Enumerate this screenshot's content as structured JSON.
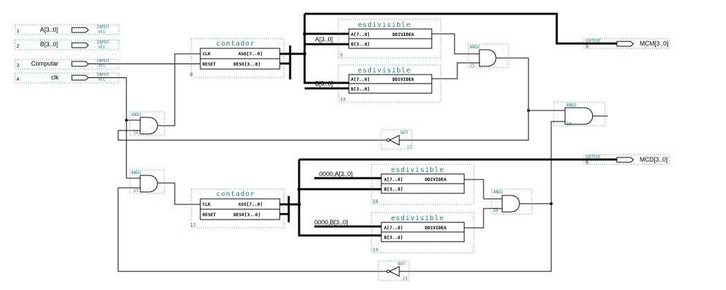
{
  "inputs": [
    {
      "num": "1",
      "name": "A[3..0]",
      "type": "INPUT",
      "vcc": "VCC"
    },
    {
      "num": "2",
      "name": "B[3..0]",
      "type": "INPUT",
      "vcc": "VCC"
    },
    {
      "num": "3",
      "name": "Computar",
      "type": "INPUT",
      "vcc": "VCC"
    },
    {
      "num": "4",
      "name": "clk",
      "type": "INPUT",
      "vcc": "VCC"
    }
  ],
  "outputs": [
    {
      "num": "5",
      "name": "MCM[3..0]",
      "type": "OUTPUT"
    },
    {
      "num": "6",
      "name": "MCD[3..0]",
      "type": "OUTPUT"
    }
  ],
  "contador_top": {
    "title": "contador",
    "num": "8",
    "port_clk": "CLK",
    "port_reset": "RESET",
    "port_aso": "ASO[7..0]",
    "port_deso": "DESO[3..0]"
  },
  "contador_bot": {
    "title": "contador",
    "num": "12",
    "port_clk": "CLK",
    "port_reset": "RESET",
    "port_aso": "ASO[7..0]",
    "port_deso": "DESO[3..0]"
  },
  "esdiv_9": {
    "title": "esdivisible",
    "num": "9",
    "port_a": "A[7..0]",
    "port_b": "B[3..0]",
    "port_out": "DDIVIDEA"
  },
  "esdiv_14": {
    "title": "esdivisible",
    "num": "14",
    "port_a": "A[7..0]",
    "port_b": "B[3..0]",
    "port_out": "DDIVIDEA"
  },
  "esdiv_18": {
    "title": "esdivisible",
    "num": "18",
    "port_a": "A[7..0]",
    "port_b": "B[3..0]",
    "port_out": "DDIVIDEA"
  },
  "esdiv_19": {
    "title": "esdivisible",
    "num": "19",
    "port_a": "A[7..0]",
    "port_b": "B[3..0]",
    "port_out": "DDIVIDEA"
  },
  "gates": {
    "and_11": {
      "type": "AND2",
      "num": "11"
    },
    "and_13": {
      "type": "AND2",
      "num": "13"
    },
    "and_15": {
      "type": "AND2",
      "num": "15"
    },
    "and_16": {
      "type": "AND2",
      "num": "16"
    },
    "and_20": {
      "type": "AND2",
      "num": "20"
    },
    "not_17": {
      "type": "NOT",
      "num": "17"
    },
    "not_21": {
      "type": "NOT",
      "num": "21"
    }
  },
  "wire_labels": {
    "a_top": "A[3..0]",
    "b_top": "B[3..0]",
    "a_bot": "0000,A[3..0]",
    "b_bot": "0000,B[3..0]"
  }
}
